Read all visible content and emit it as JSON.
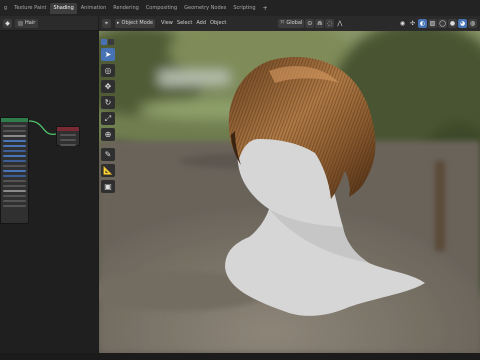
{
  "workspace_tabs": [
    {
      "label": "g",
      "active": false
    },
    {
      "label": "Texture Paint",
      "active": false
    },
    {
      "label": "Shading",
      "active": true
    },
    {
      "label": "Animation",
      "active": false
    },
    {
      "label": "Rendering",
      "active": false
    },
    {
      "label": "Compositing",
      "active": false
    },
    {
      "label": "Geometry Nodes",
      "active": false
    },
    {
      "label": "Scripting",
      "active": false
    }
  ],
  "add_tab_label": "+",
  "node_editor": {
    "material_name": "Hair"
  },
  "viewport": {
    "mode_label": "Object Mode",
    "menus": [
      "View",
      "Select",
      "Add",
      "Object"
    ],
    "transform_orientation": "Global",
    "colors": {
      "background_path": "#6b6e5f",
      "foliage": "#4d5a35",
      "hair_base": "#7a4f2a",
      "hair_highlight": "#c48b55",
      "head_mesh": "#d6d6d6"
    }
  },
  "tools": [
    {
      "icon": "cursor-select-icon",
      "glyph": "➤",
      "active": true
    },
    {
      "icon": "3d-cursor-icon",
      "glyph": "◎",
      "active": false
    },
    {
      "icon": "move-icon",
      "glyph": "✥",
      "active": false
    },
    {
      "icon": "rotate-icon",
      "glyph": "↻",
      "active": false
    },
    {
      "icon": "scale-icon",
      "glyph": "⤢",
      "active": false
    },
    {
      "icon": "transform-icon",
      "glyph": "⊕",
      "active": false
    },
    {
      "icon": "annotate-icon",
      "glyph": "✎",
      "active": false
    },
    {
      "icon": "measure-icon",
      "glyph": "📐",
      "active": false
    },
    {
      "icon": "add-cube-icon",
      "glyph": "▣",
      "active": false
    }
  ]
}
